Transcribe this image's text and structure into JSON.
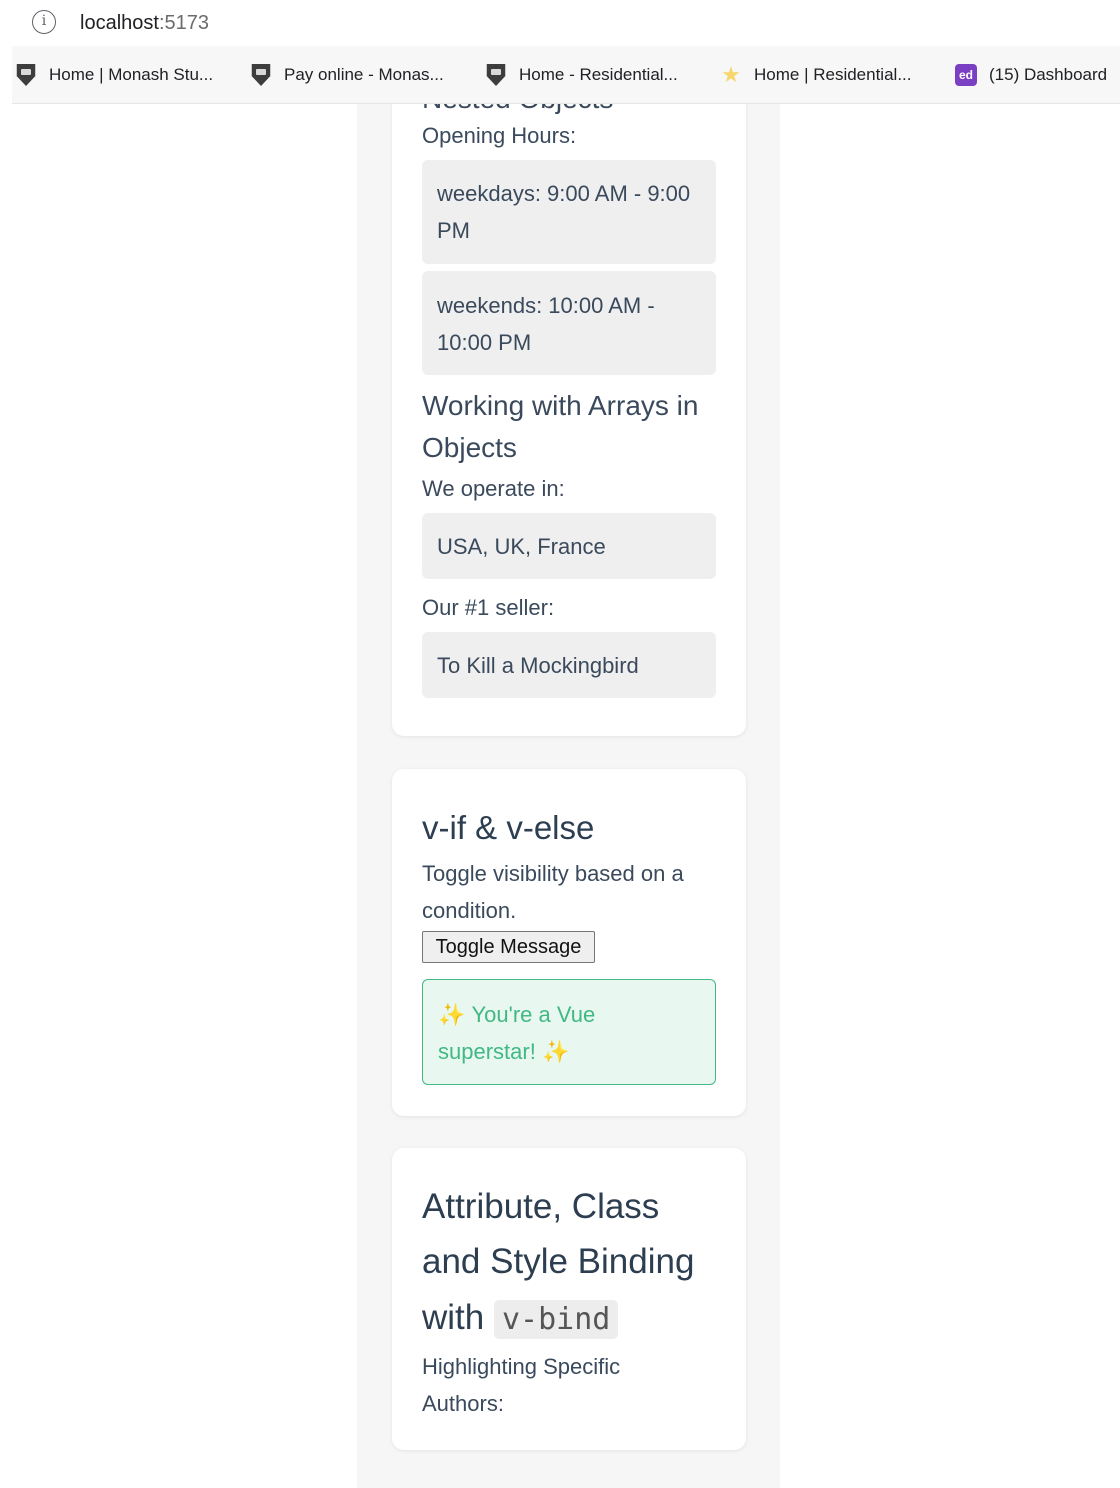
{
  "browser": {
    "url_host": "localhost",
    "url_port": ":5173",
    "bookmarks": [
      {
        "label": "Home | Monash Stu...",
        "icon": "monash-shield-icon"
      },
      {
        "label": "Pay online - Monas...",
        "icon": "monash-shield-icon"
      },
      {
        "label": "Home - Residential...",
        "icon": "monash-shield-icon"
      },
      {
        "label": "Home | Residential...",
        "icon": "star-icon"
      },
      {
        "label": "(15) Dashboard",
        "icon": "ed-icon",
        "icon_text": "ed"
      }
    ]
  },
  "nested_objects": {
    "heading_partial": "Nested Objects",
    "opening_label": "Opening Hours:",
    "weekdays_line1": "weekdays: 9:00 AM - 9:00",
    "weekdays_line2": "PM",
    "weekends_line1": "weekends: 10:00 AM -",
    "weekends_line2": "10:00 PM"
  },
  "arrays_in_objects": {
    "heading_line1": "Working with Arrays in",
    "heading_line2": "Objects",
    "operate_label": "We operate in:",
    "countries": "USA, UK, France",
    "seller_label": "Our #1 seller:",
    "seller": "To Kill a Mockingbird"
  },
  "vif_card": {
    "heading": "v-if & v-else",
    "desc_line1": "Toggle visibility based on a",
    "desc_line2": "condition.",
    "button_label": "Toggle Message",
    "message_line1": "You're a Vue",
    "message_line2": "superstar!",
    "sparkle": "✨"
  },
  "binding_card": {
    "heading_line1": "Attribute, Class",
    "heading_line2": "and Style Binding",
    "heading_line3_prefix": "with",
    "heading_code": "v-bind",
    "desc_line1": "Highlighting Specific",
    "desc_line2": "Authors:"
  }
}
